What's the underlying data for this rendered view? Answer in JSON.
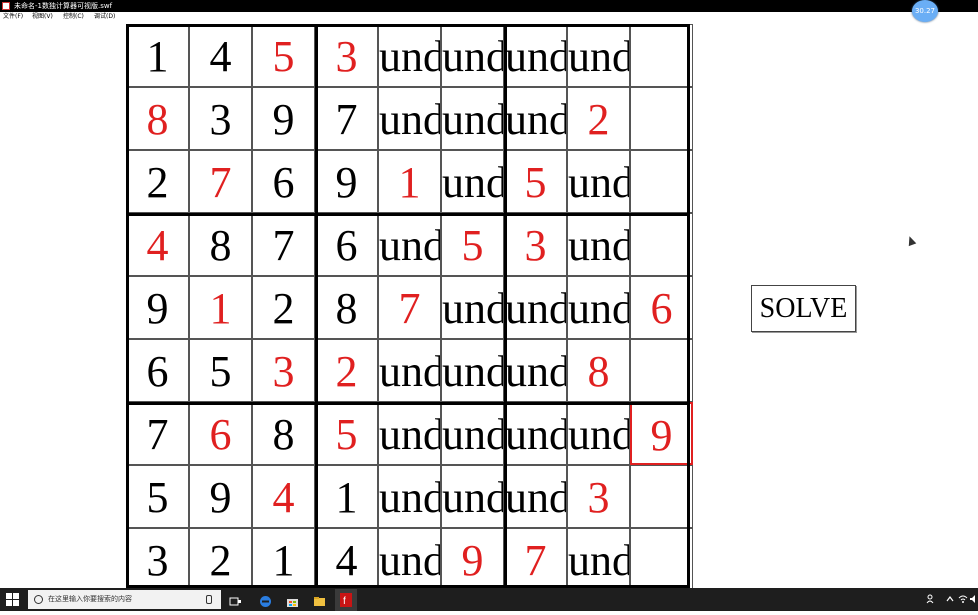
{
  "window": {
    "title": "未命名-1数独计算器可视版.swf"
  },
  "menu": {
    "items": [
      "文件(F)",
      "视图(V)",
      "控制(C)",
      "调试(D)"
    ]
  },
  "badge": {
    "text": "30.27"
  },
  "sudoku": {
    "rows": [
      [
        {
          "v": "1",
          "red": false
        },
        {
          "v": "4",
          "red": false
        },
        {
          "v": "5",
          "red": true
        },
        {
          "v": "3",
          "red": true
        },
        {
          "v": "undefined",
          "red": false
        },
        {
          "v": "undefined",
          "red": false
        },
        {
          "v": "undefined",
          "red": false
        },
        {
          "v": "undefined",
          "red": false
        },
        {
          "v": "",
          "red": false
        }
      ],
      [
        {
          "v": "8",
          "red": true
        },
        {
          "v": "3",
          "red": false
        },
        {
          "v": "9",
          "red": false
        },
        {
          "v": "7",
          "red": false
        },
        {
          "v": "undefined",
          "red": false
        },
        {
          "v": "undefined",
          "red": false
        },
        {
          "v": "undefined",
          "red": false
        },
        {
          "v": "2",
          "red": true
        },
        {
          "v": "",
          "red": false
        }
      ],
      [
        {
          "v": "2",
          "red": false
        },
        {
          "v": "7",
          "red": true
        },
        {
          "v": "6",
          "red": false
        },
        {
          "v": "9",
          "red": false
        },
        {
          "v": "1",
          "red": true
        },
        {
          "v": "undefined",
          "red": false
        },
        {
          "v": "5",
          "red": true
        },
        {
          "v": "undefined",
          "red": false
        },
        {
          "v": "",
          "red": false
        }
      ],
      [
        {
          "v": "4",
          "red": true
        },
        {
          "v": "8",
          "red": false
        },
        {
          "v": "7",
          "red": false
        },
        {
          "v": "6",
          "red": false
        },
        {
          "v": "undefined",
          "red": false
        },
        {
          "v": "5",
          "red": true
        },
        {
          "v": "3",
          "red": true
        },
        {
          "v": "undefined",
          "red": false
        },
        {
          "v": "",
          "red": false
        }
      ],
      [
        {
          "v": "9",
          "red": false
        },
        {
          "v": "1",
          "red": true
        },
        {
          "v": "2",
          "red": false
        },
        {
          "v": "8",
          "red": false
        },
        {
          "v": "7",
          "red": true
        },
        {
          "v": "undefined",
          "red": false
        },
        {
          "v": "undefined",
          "red": false
        },
        {
          "v": "undefined",
          "red": false
        },
        {
          "v": "6",
          "red": true
        }
      ],
      [
        {
          "v": "6",
          "red": false
        },
        {
          "v": "5",
          "red": false
        },
        {
          "v": "3",
          "red": true
        },
        {
          "v": "2",
          "red": true
        },
        {
          "v": "undefined",
          "red": false
        },
        {
          "v": "undefined",
          "red": false
        },
        {
          "v": "undefined",
          "red": false
        },
        {
          "v": "8",
          "red": true
        },
        {
          "v": "",
          "red": false
        }
      ],
      [
        {
          "v": "7",
          "red": false
        },
        {
          "v": "6",
          "red": true
        },
        {
          "v": "8",
          "red": false
        },
        {
          "v": "5",
          "red": true
        },
        {
          "v": "undefined",
          "red": false
        },
        {
          "v": "undefined",
          "red": false
        },
        {
          "v": "undefined",
          "red": false
        },
        {
          "v": "undefined",
          "red": false
        },
        {
          "v": "9",
          "red": true,
          "selected": true
        }
      ],
      [
        {
          "v": "5",
          "red": false
        },
        {
          "v": "9",
          "red": false
        },
        {
          "v": "4",
          "red": true
        },
        {
          "v": "1",
          "red": false
        },
        {
          "v": "undefined",
          "red": false
        },
        {
          "v": "undefined",
          "red": false
        },
        {
          "v": "undefined",
          "red": false
        },
        {
          "v": "3",
          "red": true
        },
        {
          "v": "",
          "red": false
        }
      ],
      [
        {
          "v": "3",
          "red": false
        },
        {
          "v": "2",
          "red": false
        },
        {
          "v": "1",
          "red": false
        },
        {
          "v": "4",
          "red": false
        },
        {
          "v": "undefined",
          "red": false
        },
        {
          "v": "9",
          "red": true
        },
        {
          "v": "7",
          "red": true
        },
        {
          "v": "undefined",
          "red": false
        },
        {
          "v": "",
          "red": false
        }
      ]
    ]
  },
  "solve_button": {
    "label": "SOLVE"
  },
  "taskbar": {
    "search_placeholder": "在这里输入你要搜索的内容",
    "icons": [
      "task-view-icon",
      "edge-icon",
      "store-icon",
      "file-explorer-icon",
      "flash-player-icon"
    ],
    "tray_icons": [
      "person-icon",
      "chevron-up-icon",
      "network-icon",
      "volume-icon"
    ]
  },
  "colors": {
    "red": "#e02020",
    "black": "#000000",
    "taskbar": "#1e1e1e",
    "badge": "#6aaef5"
  }
}
